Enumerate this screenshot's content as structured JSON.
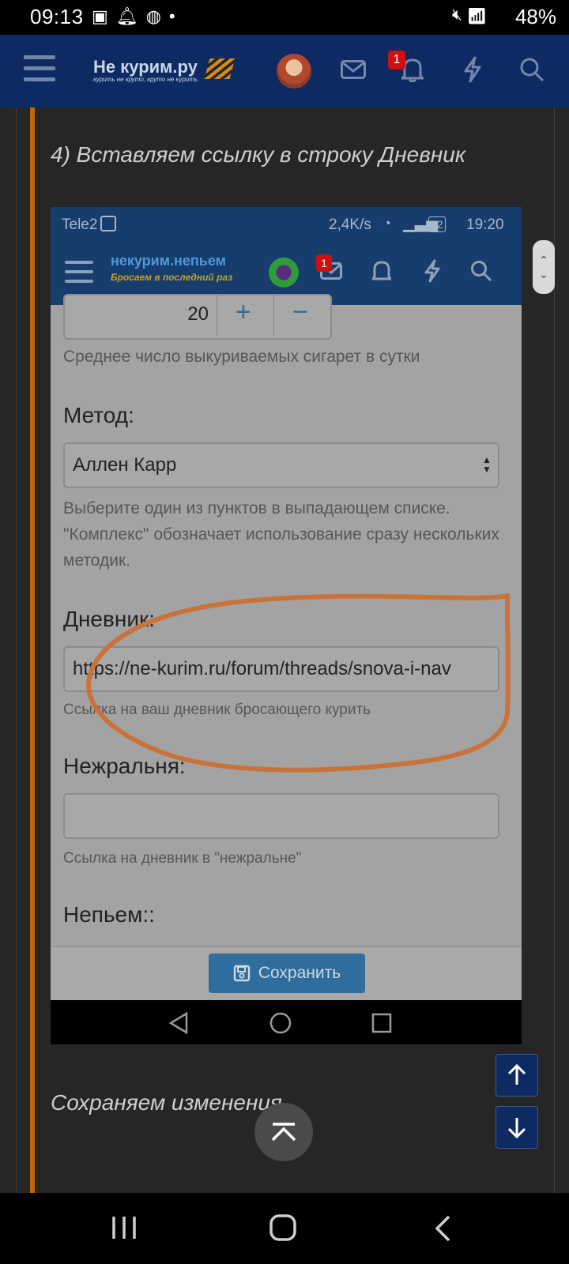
{
  "status_bar": {
    "time": "09:13",
    "battery": "48%"
  },
  "site": {
    "logo_text": "Не курим.ру",
    "logo_tagline": "курить не круто, круто не курить",
    "notification_count": "1"
  },
  "post": {
    "step_heading": "4) Вставляем ссылку в строку Дневник",
    "caption_after": "Сохраняем изменения"
  },
  "screenshot": {
    "status": {
      "carrier": "Tele2",
      "speed": "2,4K/s",
      "battery": "22",
      "time": "19:20"
    },
    "logo_text": "некурим.непьем",
    "logo_tagline": "Бросаем в последний раз",
    "message_badge": "1",
    "form": {
      "cigarettes_value": "20",
      "plus": "+",
      "minus": "−",
      "cigarettes_hint": "Среднее число выкуриваемых сигарет в сутки",
      "method_label": "Метод:",
      "method_value": "Аллен Карр",
      "method_hint": "Выберите один из пунктов в выпадающем списке. \"Комплекс\" обозначает использование сразу нескольких методик.",
      "diary_label": "Дневник:",
      "diary_value": "https://ne-kurim.ru/forum/threads/snova-i-nav",
      "diary_hint": "Ссылка на ваш дневник бросающего курить",
      "nezhralnya_label": "Нежральня:",
      "nezhralnya_value": "",
      "nezhralnya_hint": "Ссылка на дневник в \"нежральне\"",
      "nepyem_label": "Непьем::",
      "save_label": "Сохранить"
    }
  },
  "colors": {
    "header": "#0d2a63",
    "accent": "#c2660d",
    "annotation": "#c8733a"
  }
}
